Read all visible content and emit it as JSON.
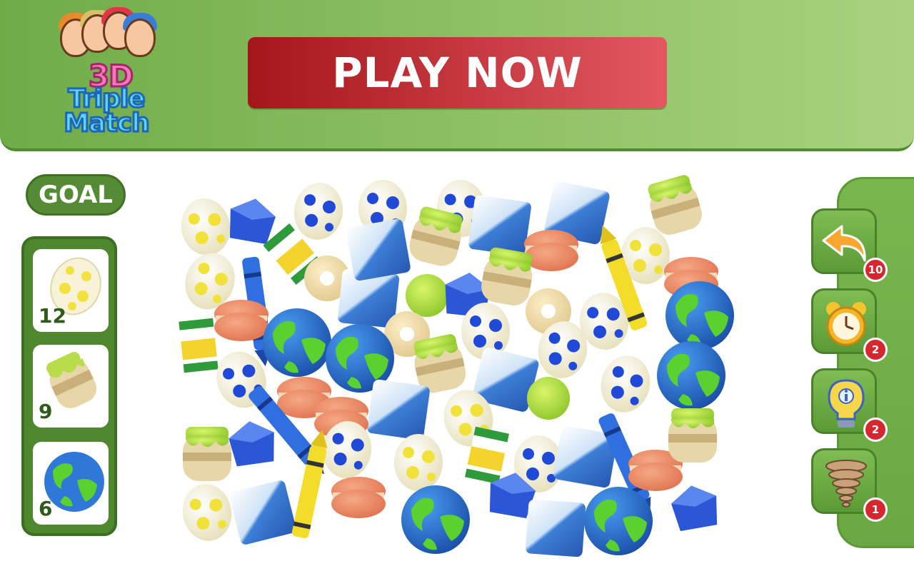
{
  "logo": {
    "line1": "3D",
    "line2": "Triple",
    "line3": "Match"
  },
  "cta": {
    "label": "PLAY NOW"
  },
  "goal": {
    "title": "GOAL",
    "items": [
      {
        "icon": "egg-icon",
        "count": "12"
      },
      {
        "icon": "jar-icon",
        "count": "9"
      },
      {
        "icon": "globe-icon",
        "count": "6"
      }
    ]
  },
  "tools": [
    {
      "icon": "undo-arrow-icon",
      "count": "10"
    },
    {
      "icon": "alarm-clock-icon",
      "count": "2"
    },
    {
      "icon": "lightbulb-hint-icon",
      "count": "2"
    },
    {
      "icon": "tornado-shuffle-icon",
      "count": "1"
    }
  ],
  "colors": {
    "header_green": "#8fc064",
    "play_red": "#c7323a",
    "goal_green": "#4f872f",
    "badge_red": "#d7262e"
  }
}
